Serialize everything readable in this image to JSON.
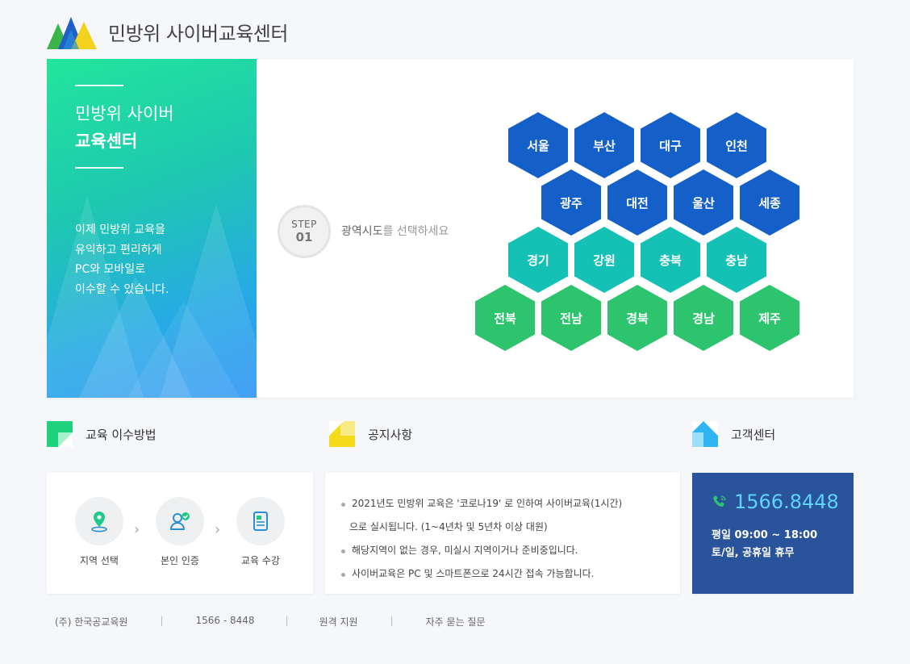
{
  "header": {
    "title": "민방위 사이버교육센터",
    "logo_icon": "mountain-logo-icon"
  },
  "hero": {
    "title_line1": "민방위 사이버",
    "title_line2": "교육센터",
    "description": " 이제 민방위 교육을\n유익하고 편리하게\nPC와 모바일로\n이수할 수 있습니다."
  },
  "step": {
    "label": "STEP",
    "number": "01",
    "instruction_bold": "광역시도",
    "instruction_rest": "를 선택하세요"
  },
  "regions": {
    "row1": [
      "서울",
      "부산",
      "대구",
      "인천"
    ],
    "row2": [
      "광주",
      "대전",
      "울산",
      "세종"
    ],
    "row3": [
      "경기",
      "강원",
      "충북",
      "충남"
    ],
    "row4": [
      "전북",
      "전남",
      "경북",
      "경남",
      "제주"
    ],
    "colors": {
      "blue": "#155fc9",
      "teal": "#14c1b4",
      "green": "#2ec46d"
    }
  },
  "sections": {
    "method": "교육 이수방법",
    "notice": "공지사항",
    "support": "고객센터"
  },
  "method_steps": [
    "지역 선택",
    "본인 인증",
    "교육 수강"
  ],
  "notices": {
    "item1_line1": "2021년도 민방위 교육은 '코로나19' 로 인하여 사이버교육(1시간)",
    "item1_line2": "으로 실시됩니다. (1~4년차 및 5년차 이상 대원)",
    "item2": "해당지역이 없는 경우, 미실시 지역이거나 준비중입니다.",
    "item3": "사이버교육은 PC 및 스마트폰으로 24시간 접속 가능합니다."
  },
  "support": {
    "phone": "1566.8448",
    "hours": "평일 09:00 ~ 18:00",
    "holiday": "토/일, 공휴일 휴무"
  },
  "footer": {
    "company": "(주) 한국공교육원",
    "sep": "|",
    "phone": "1566 - 8448",
    "remote": "원격 지원",
    "faq": "자주 묻는 질문"
  }
}
